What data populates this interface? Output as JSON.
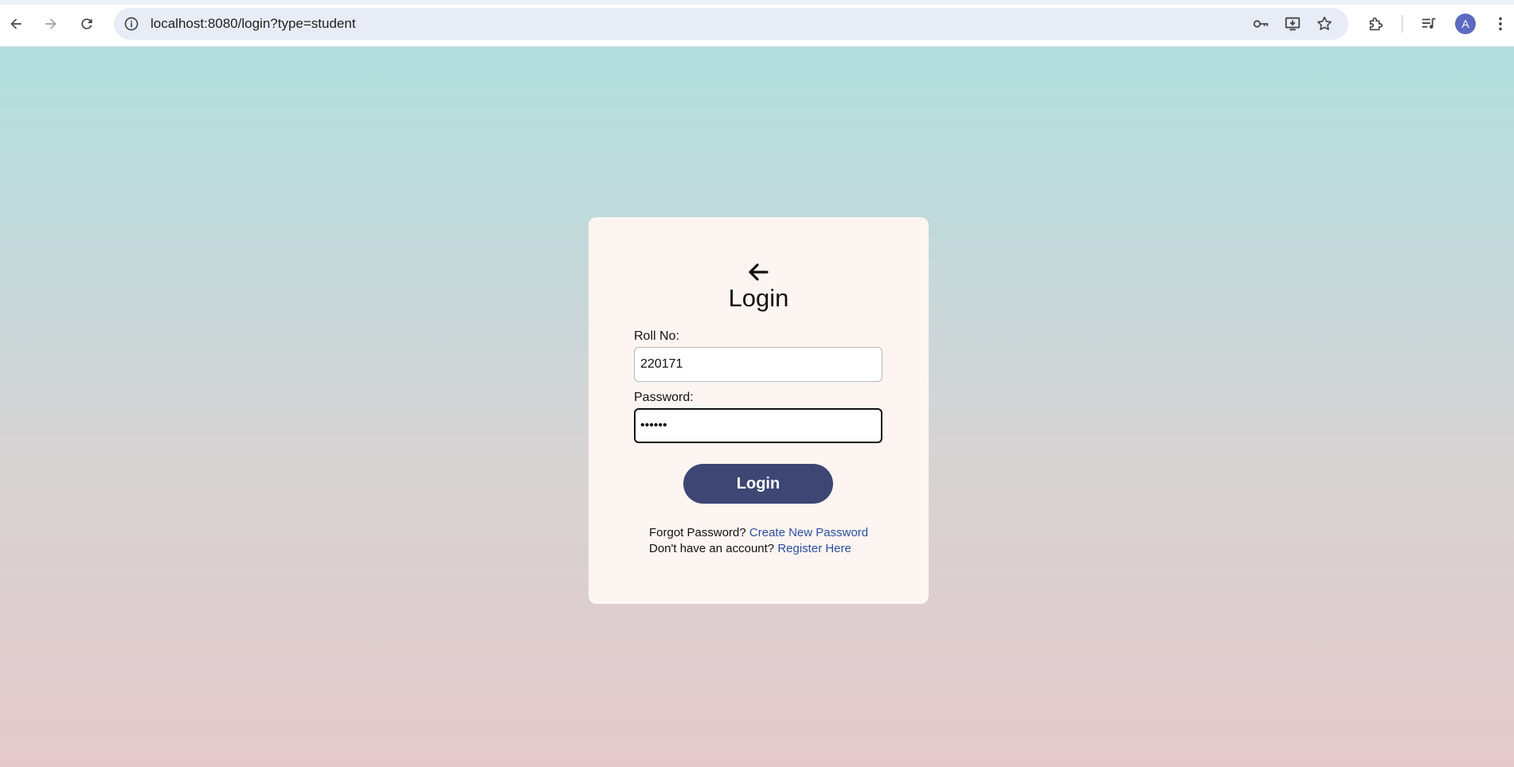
{
  "browser": {
    "url": "localhost:8080/login?type=student",
    "profile_initial": "A",
    "icons": {
      "back": "arrow-left-icon",
      "forward": "arrow-right-icon",
      "reload": "reload-icon",
      "site_info": "info-icon",
      "password_key": "key-icon",
      "install_app": "install-icon",
      "bookmark": "star-icon",
      "extensions": "puzzle-icon",
      "media": "media-queue-icon",
      "menu": "more-vert-icon"
    }
  },
  "login": {
    "title": "Login",
    "rollno_label": "Roll No:",
    "rollno_value": "220171",
    "password_label": "Password:",
    "password_value": "••••••",
    "submit_label": "Login",
    "forgot_text": "Forgot Password?",
    "forgot_link": "Create New Password",
    "register_text": "Don't have an account?",
    "register_link": "Register Here"
  },
  "colors": {
    "button_bg": "#3e4674",
    "link": "#2a4f9e",
    "card_bg": "#fdf5f1",
    "gradient_top": "#b1dfdd",
    "gradient_bottom": "#e4c9cb"
  }
}
